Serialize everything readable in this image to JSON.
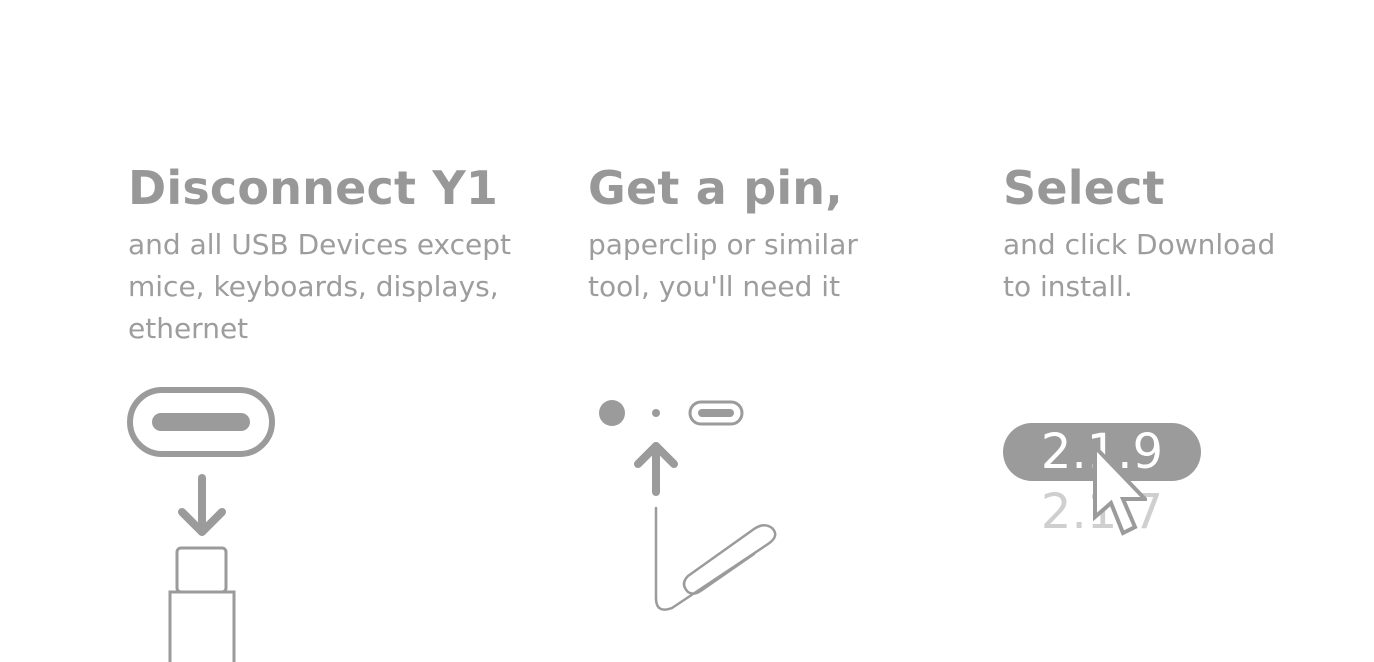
{
  "steps": [
    {
      "title": "Disconnect Y1",
      "description": "and all USB Devices except\nmice, keyboards, displays,\nethernet",
      "icon": "usb-c-disconnect-icon"
    },
    {
      "title": "Get a pin,",
      "description": "paperclip or similar\ntool, you'll need it",
      "icon": "paperclip-reset-icon"
    },
    {
      "title": "Select",
      "description": "and click Download\nto install.",
      "icon": "version-select-icon"
    }
  ],
  "version_picker": {
    "selected": "2.1.9",
    "other": "2.1.7"
  },
  "colors": {
    "text": "#989898",
    "illustration": "#9b9b9b",
    "muted": "#cfcfcf",
    "background": "#ffffff"
  }
}
